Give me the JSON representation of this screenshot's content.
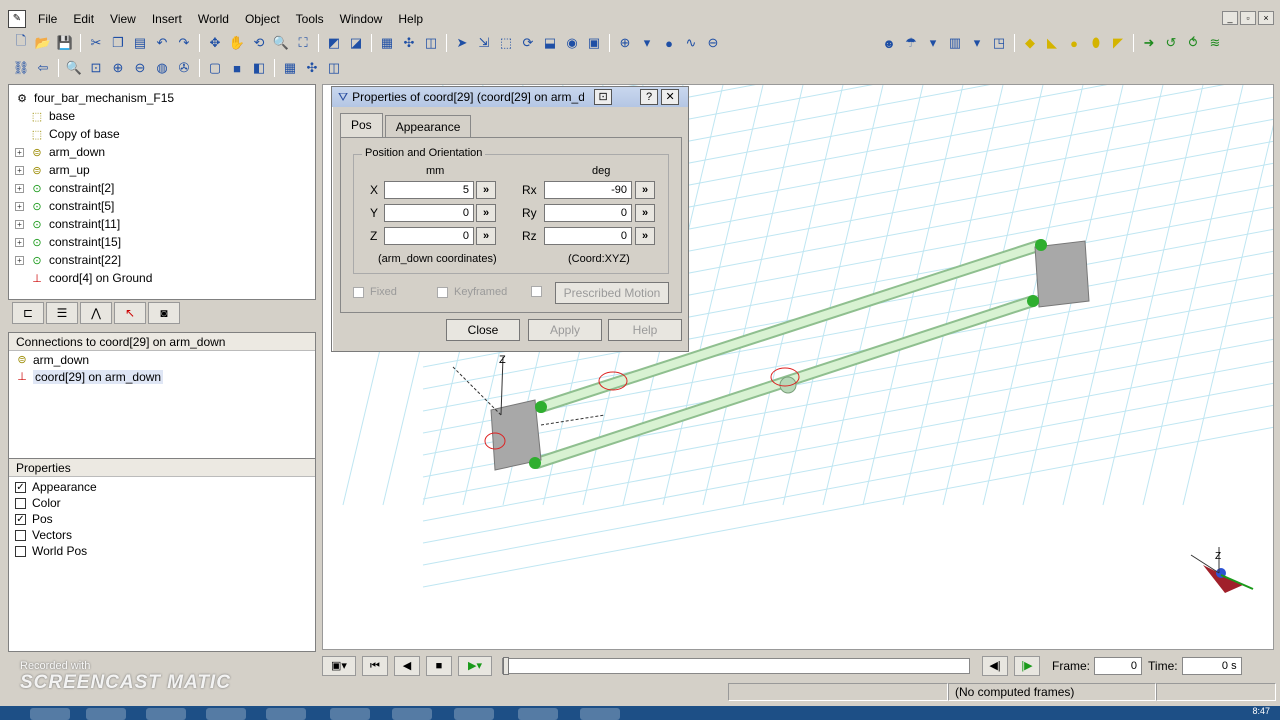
{
  "app": {
    "window_controls": [
      "_",
      "▫",
      "×"
    ]
  },
  "menu": [
    "File",
    "Edit",
    "View",
    "Insert",
    "World",
    "Object",
    "Tools",
    "Window",
    "Help"
  ],
  "tree": {
    "root": "four_bar_mechanism_F15",
    "items": [
      {
        "label": "base",
        "icon": "part-box-icon",
        "expand": false
      },
      {
        "label": "Copy of base",
        "icon": "part-box-icon",
        "expand": false
      },
      {
        "label": "arm_down",
        "icon": "part-cylinder-icon",
        "expand": true
      },
      {
        "label": "arm_up",
        "icon": "part-cylinder-icon",
        "expand": true
      },
      {
        "label": "constraint[2]",
        "icon": "constraint-icon",
        "expand": true
      },
      {
        "label": "constraint[5]",
        "icon": "constraint-icon",
        "expand": true
      },
      {
        "label": "constraint[11]",
        "icon": "constraint-icon",
        "expand": true
      },
      {
        "label": "constraint[15]",
        "icon": "constraint-icon",
        "expand": true
      },
      {
        "label": "constraint[22]",
        "icon": "constraint-icon",
        "expand": true
      },
      {
        "label": "coord[4] on Ground",
        "icon": "coord-icon",
        "expand": false
      }
    ]
  },
  "connections": {
    "header": "Connections to coord[29] on arm_down",
    "items": [
      "arm_down",
      "coord[29] on arm_down"
    ]
  },
  "properties": {
    "header": "Properties",
    "items": [
      {
        "label": "Appearance",
        "checked": true
      },
      {
        "label": "Color",
        "checked": false
      },
      {
        "label": "Pos",
        "checked": true
      },
      {
        "label": "Vectors",
        "checked": false
      },
      {
        "label": "World Pos",
        "checked": false
      }
    ]
  },
  "dialog": {
    "title": "Properties of coord[29] (coord[29] on arm_d",
    "tabs": [
      "Pos",
      "Appearance"
    ],
    "group_label": "Position and Orientation",
    "unit_left": "mm",
    "unit_right": "deg",
    "fields": {
      "X": "5",
      "Y": "0",
      "Z": "0",
      "Rx": "-90",
      "Ry": "0",
      "Rz": "0"
    },
    "more_glyph": "»",
    "coords_left": "(arm_down coordinates)",
    "coords_right": "(Coord:XYZ)",
    "fixed": "Fixed",
    "keyframed": "Keyframed",
    "prescribed": "Prescribed Motion",
    "close": "Close",
    "apply": "Apply",
    "help": "Help"
  },
  "playback": {
    "frame_label": "Frame:",
    "frame_value": "0",
    "time_label": "Time:",
    "time_value": "0 s"
  },
  "status": {
    "message": "(No computed frames)"
  },
  "watermark": {
    "line1": "Recorded with",
    "line2": "SCREENCAST MATIC"
  },
  "clock": "8:47"
}
